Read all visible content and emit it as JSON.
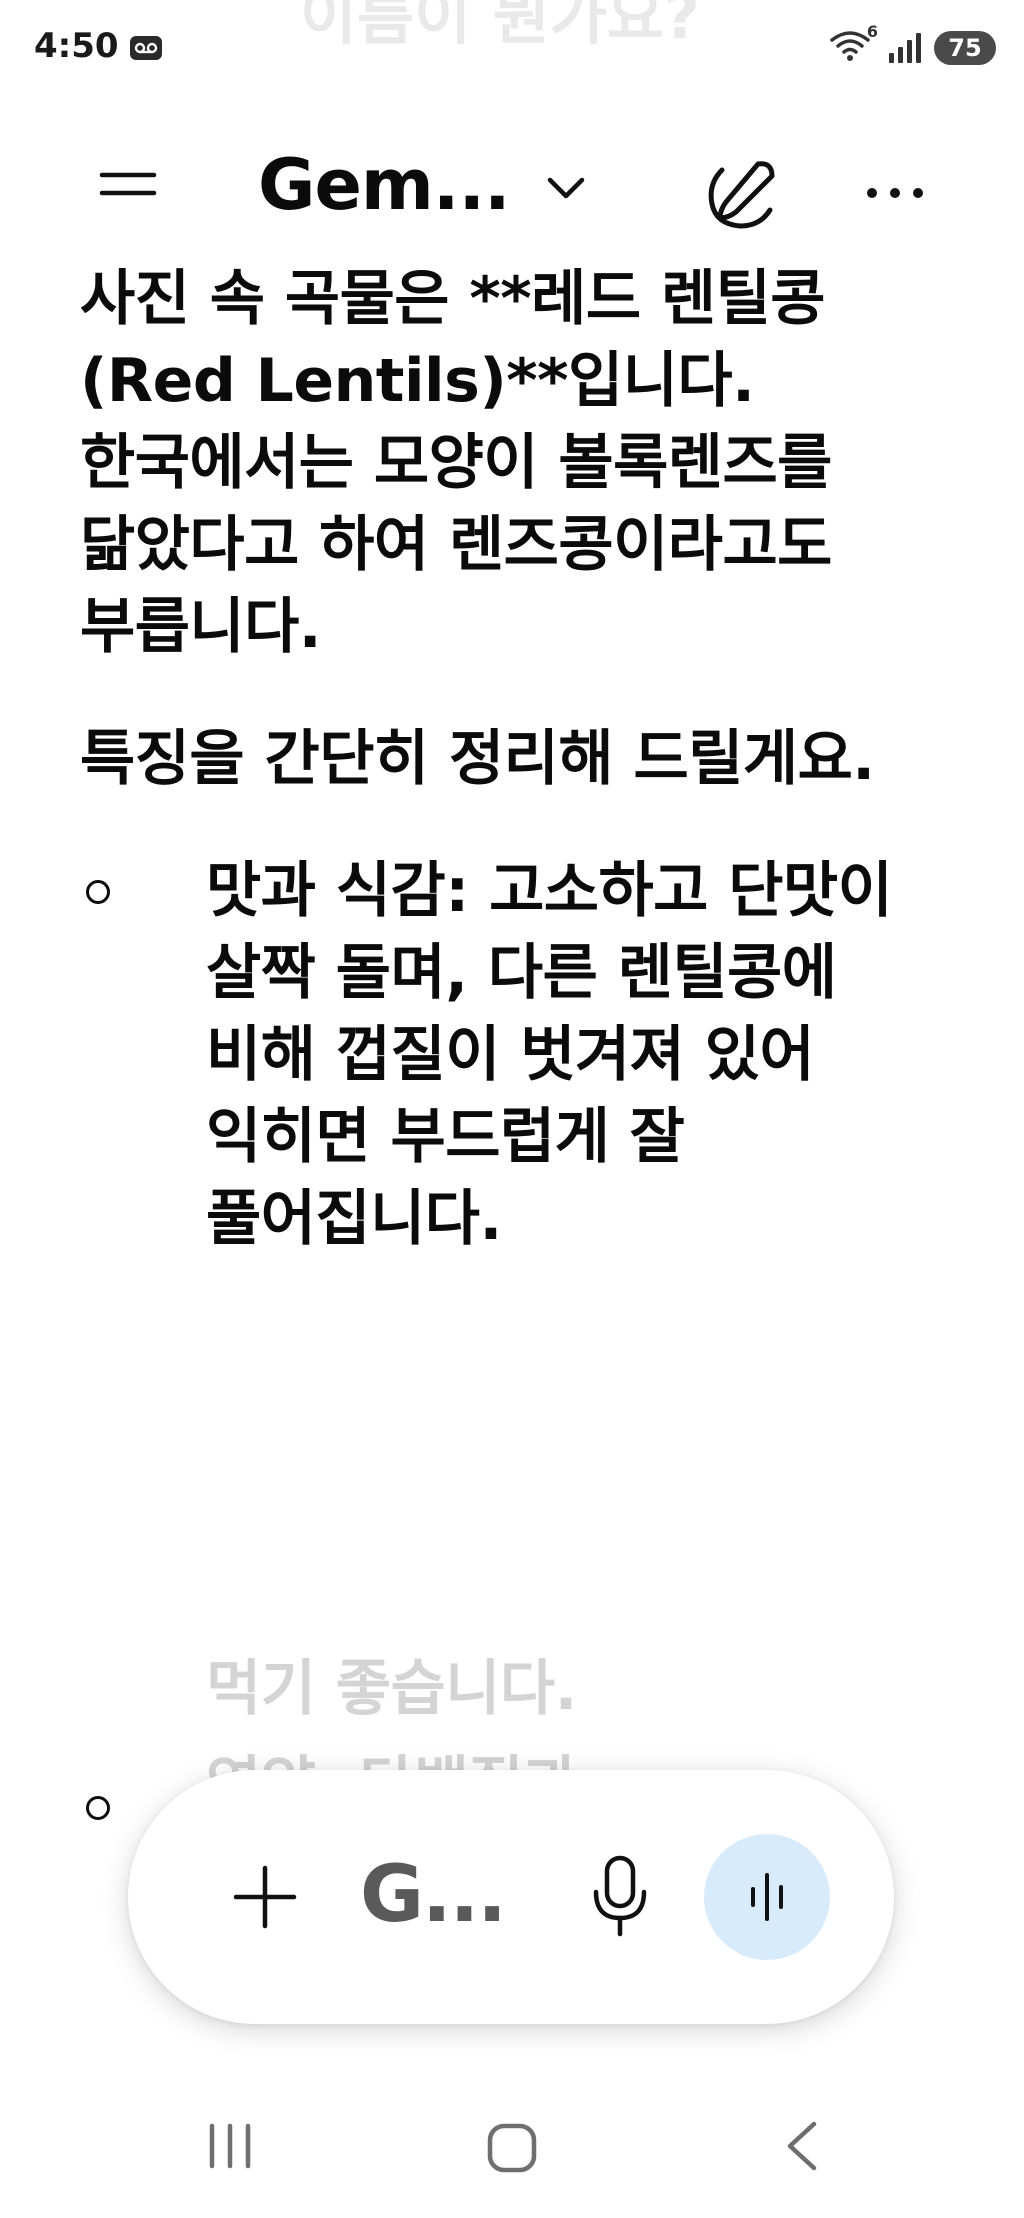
{
  "status_bar": {
    "time": "4:50",
    "voicemail_icon": "voicemail-icon",
    "wifi_badge": "6",
    "battery": "75",
    "ghost_text": "이름이 뭔가요?"
  },
  "app_bar": {
    "title": "Gem...",
    "icons": {
      "menu": "menu-icon",
      "chevron": "chevron-down-icon",
      "new_chat": "edit-pen-icon",
      "more": "more-horizontal-icon"
    }
  },
  "response": {
    "paragraphs": [
      "사진 속 곡물은 **레드 렌틸콩(Red Lentils)**입니다. 한국에서는 모양이 볼록렌즈를 닮았다고 하여 렌즈콩이라고도 부릅니다.",
      "특징을 간단히 정리해 드릴게요."
    ],
    "bullets": [
      "맛과 식감: 고소하고 단맛이 살짝 돌며, 다른 렌틸콩에 비해 껍질이 벗겨져 있어 익히면 부드럽게 잘 풀어집니다.",
      "먹기 좋습니다.",
      "영양: 단백질과"
    ]
  },
  "input_bar": {
    "tool_label": "G...",
    "icons": {
      "add": "plus-icon",
      "mic": "microphone-icon",
      "live": "live-audio-icon"
    },
    "live_bg": "#d8ebfb"
  },
  "nav_bar": {
    "icons": {
      "recents": "recents-icon",
      "home": "home-icon",
      "back": "back-icon"
    }
  }
}
